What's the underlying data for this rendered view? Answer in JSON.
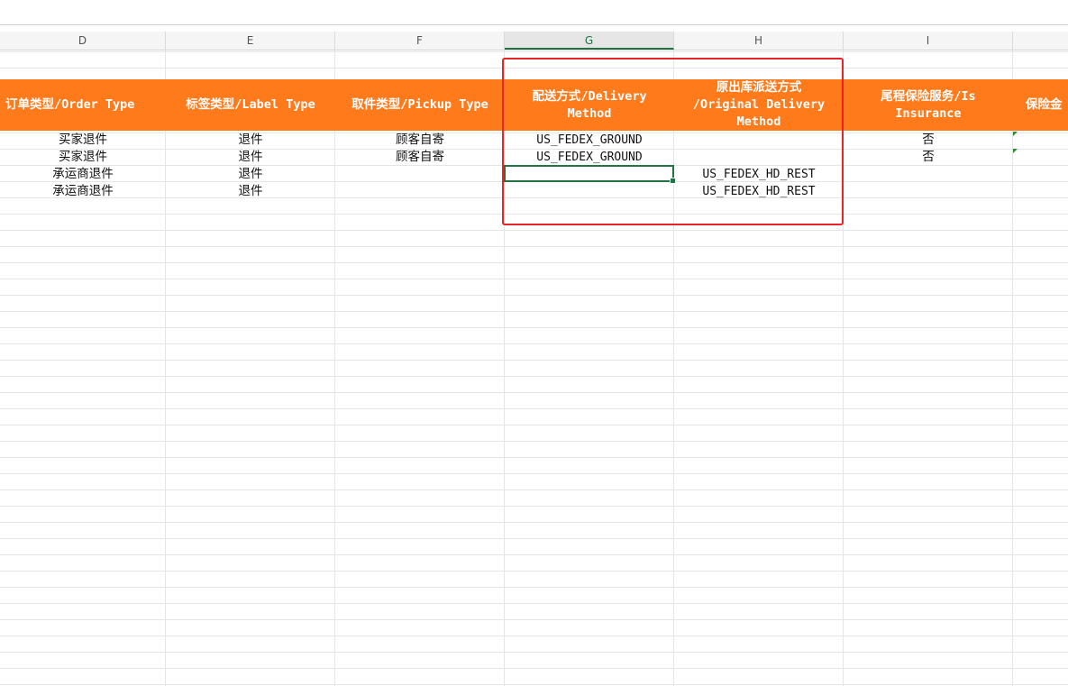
{
  "columns": [
    {
      "letter": "D",
      "active": false
    },
    {
      "letter": "E",
      "active": false
    },
    {
      "letter": "F",
      "active": false
    },
    {
      "letter": "G",
      "active": true
    },
    {
      "letter": "H",
      "active": false
    },
    {
      "letter": "I",
      "active": false
    },
    {
      "letter": "",
      "active": false
    }
  ],
  "headers": {
    "order_type": "订单类型/Order Type",
    "label_type": "标签类型/Label Type",
    "pickup_type": "取件类型/Pickup Type",
    "delivery_method": "配送方式/Delivery\nMethod",
    "original_delivery": "原出库派送方式\n/Original Delivery\nMethod",
    "is_insurance": "尾程保险服务/Is\nInsurance",
    "insurance_amount": "保险金"
  },
  "rows": [
    {
      "order_type": "买家退件",
      "label_type": "退件",
      "pickup_type": "顾客自寄",
      "delivery_method": "US_FEDEX_GROUND",
      "original_delivery": "",
      "is_insurance": "否"
    },
    {
      "order_type": "买家退件",
      "label_type": "退件",
      "pickup_type": "顾客自寄",
      "delivery_method": "US_FEDEX_GROUND",
      "original_delivery": "",
      "is_insurance": "否"
    },
    {
      "order_type": "承运商退件",
      "label_type": "退件",
      "pickup_type": "",
      "delivery_method": "",
      "original_delivery": "US_FEDEX_HD_REST",
      "is_insurance": ""
    },
    {
      "order_type": "承运商退件",
      "label_type": "退件",
      "pickup_type": "",
      "delivery_method": "",
      "original_delivery": "US_FEDEX_HD_REST",
      "is_insurance": ""
    }
  ],
  "colors": {
    "header_fill": "#ff7a1a",
    "selection": "#217346",
    "annotation": "#e8242b"
  }
}
